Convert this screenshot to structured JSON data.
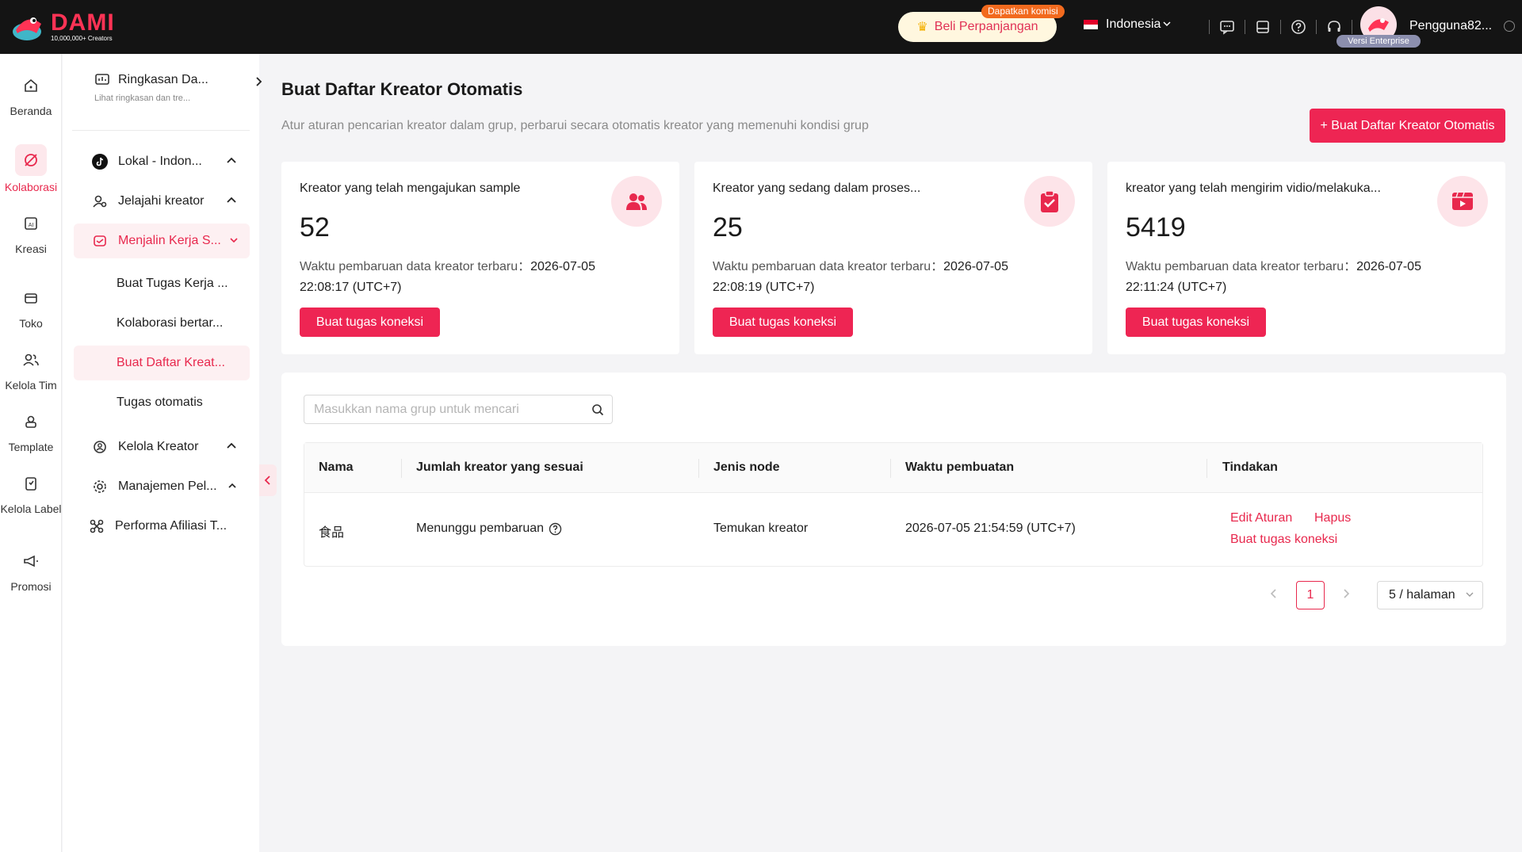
{
  "brand": {
    "name": "DAMI",
    "tagline": "10,000,000+ Creators",
    "accent": "#ee2553"
  },
  "topbar": {
    "renew_label": "Beli Perpanjangan",
    "commission_badge": "Dapatkan komisi",
    "language": "Indonesia",
    "icons": [
      "message-icon",
      "book-icon",
      "help-icon",
      "headset-icon"
    ],
    "enterprise_badge": "Versi Enterprise",
    "username": "Pengguna82..."
  },
  "rail": {
    "items": [
      {
        "label": "Beranda",
        "icon": "home-icon"
      },
      {
        "label": "Kolaborasi",
        "icon": "collab-icon",
        "active": true
      },
      {
        "label": "Kreasi",
        "icon": "ai-create-icon"
      },
      {
        "label": "Toko",
        "icon": "store-icon"
      },
      {
        "label": "Kelola Tim",
        "icon": "team-icon"
      },
      {
        "label": "Template",
        "icon": "template-icon"
      },
      {
        "label": "Kelola Label",
        "icon": "label-icon"
      },
      {
        "label": "Promosi",
        "icon": "megaphone-icon"
      }
    ]
  },
  "subnav": {
    "summary_title": "Ringkasan Da...",
    "summary_sub": "Lihat ringkasan dan tre...",
    "items": [
      {
        "label": "Lokal - Indon...",
        "icon": "tiktok-icon"
      },
      {
        "label": "Jelajahi kreator",
        "icon": "user-search-icon"
      },
      {
        "label": "Menjalin Kerja S...",
        "icon": "handshake-icon",
        "active_parent": true
      },
      {
        "label": "Buat Tugas Kerja ..."
      },
      {
        "label": "Kolaborasi bertar..."
      },
      {
        "label": "Buat Daftar Kreat...",
        "active": true
      },
      {
        "label": "Tugas otomatis"
      },
      {
        "label": "Kelola Kreator",
        "icon": "creator-manage-icon"
      },
      {
        "label": "Manajemen Pel...",
        "icon": "gear-icon"
      },
      {
        "label": "Performa Afiliasi T...",
        "icon": "affiliate-icon"
      }
    ]
  },
  "main": {
    "title": "Buat Daftar Kreator Otomatis",
    "description": "Atur aturan pencarian kreator dalam grup, perbarui secara otomatis kreator yang memenuhi kondisi grup",
    "primary_button": "+ Buat Daftar Kreator Otomatis",
    "cards": [
      {
        "title": "Kreator yang telah mengajukan sample",
        "value": "52",
        "update_label": "Waktu pembaruan data kreator terbaru：",
        "update_time": "2026-07-05 22:08:17 (UTC+7)",
        "button": "Buat tugas koneksi",
        "icon": "users-icon"
      },
      {
        "title": "Kreator yang sedang dalam proses...",
        "value": "25",
        "update_label": "Waktu pembaruan data kreator terbaru：",
        "update_time": "2026-07-05 22:08:19 (UTC+7)",
        "button": "Buat tugas koneksi",
        "icon": "clipboard-check-icon"
      },
      {
        "title": "kreator yang telah mengirim vidio/melakuka...",
        "value": "5419",
        "update_label": "Waktu pembaruan data kreator terbaru：",
        "update_time": "2026-07-05 22:11:24 (UTC+7)",
        "button": "Buat tugas koneksi",
        "icon": "video-icon"
      }
    ],
    "search_placeholder": "Masukkan nama grup untuk mencari",
    "table": {
      "columns": [
        "Nama",
        "Jumlah kreator yang sesuai",
        "Jenis node",
        "Waktu pembuatan",
        "Tindakan"
      ],
      "rows": [
        {
          "name": "食品",
          "count": "Menunggu pembaruan",
          "node_type": "Temukan kreator",
          "created": "2026-07-05 21:54:59 (UTC+7)",
          "actions": [
            "Edit Aturan",
            "Hapus",
            "Buat tugas koneksi"
          ]
        }
      ]
    },
    "pagination": {
      "current_page": "1",
      "page_size": "5 / halaman"
    }
  }
}
